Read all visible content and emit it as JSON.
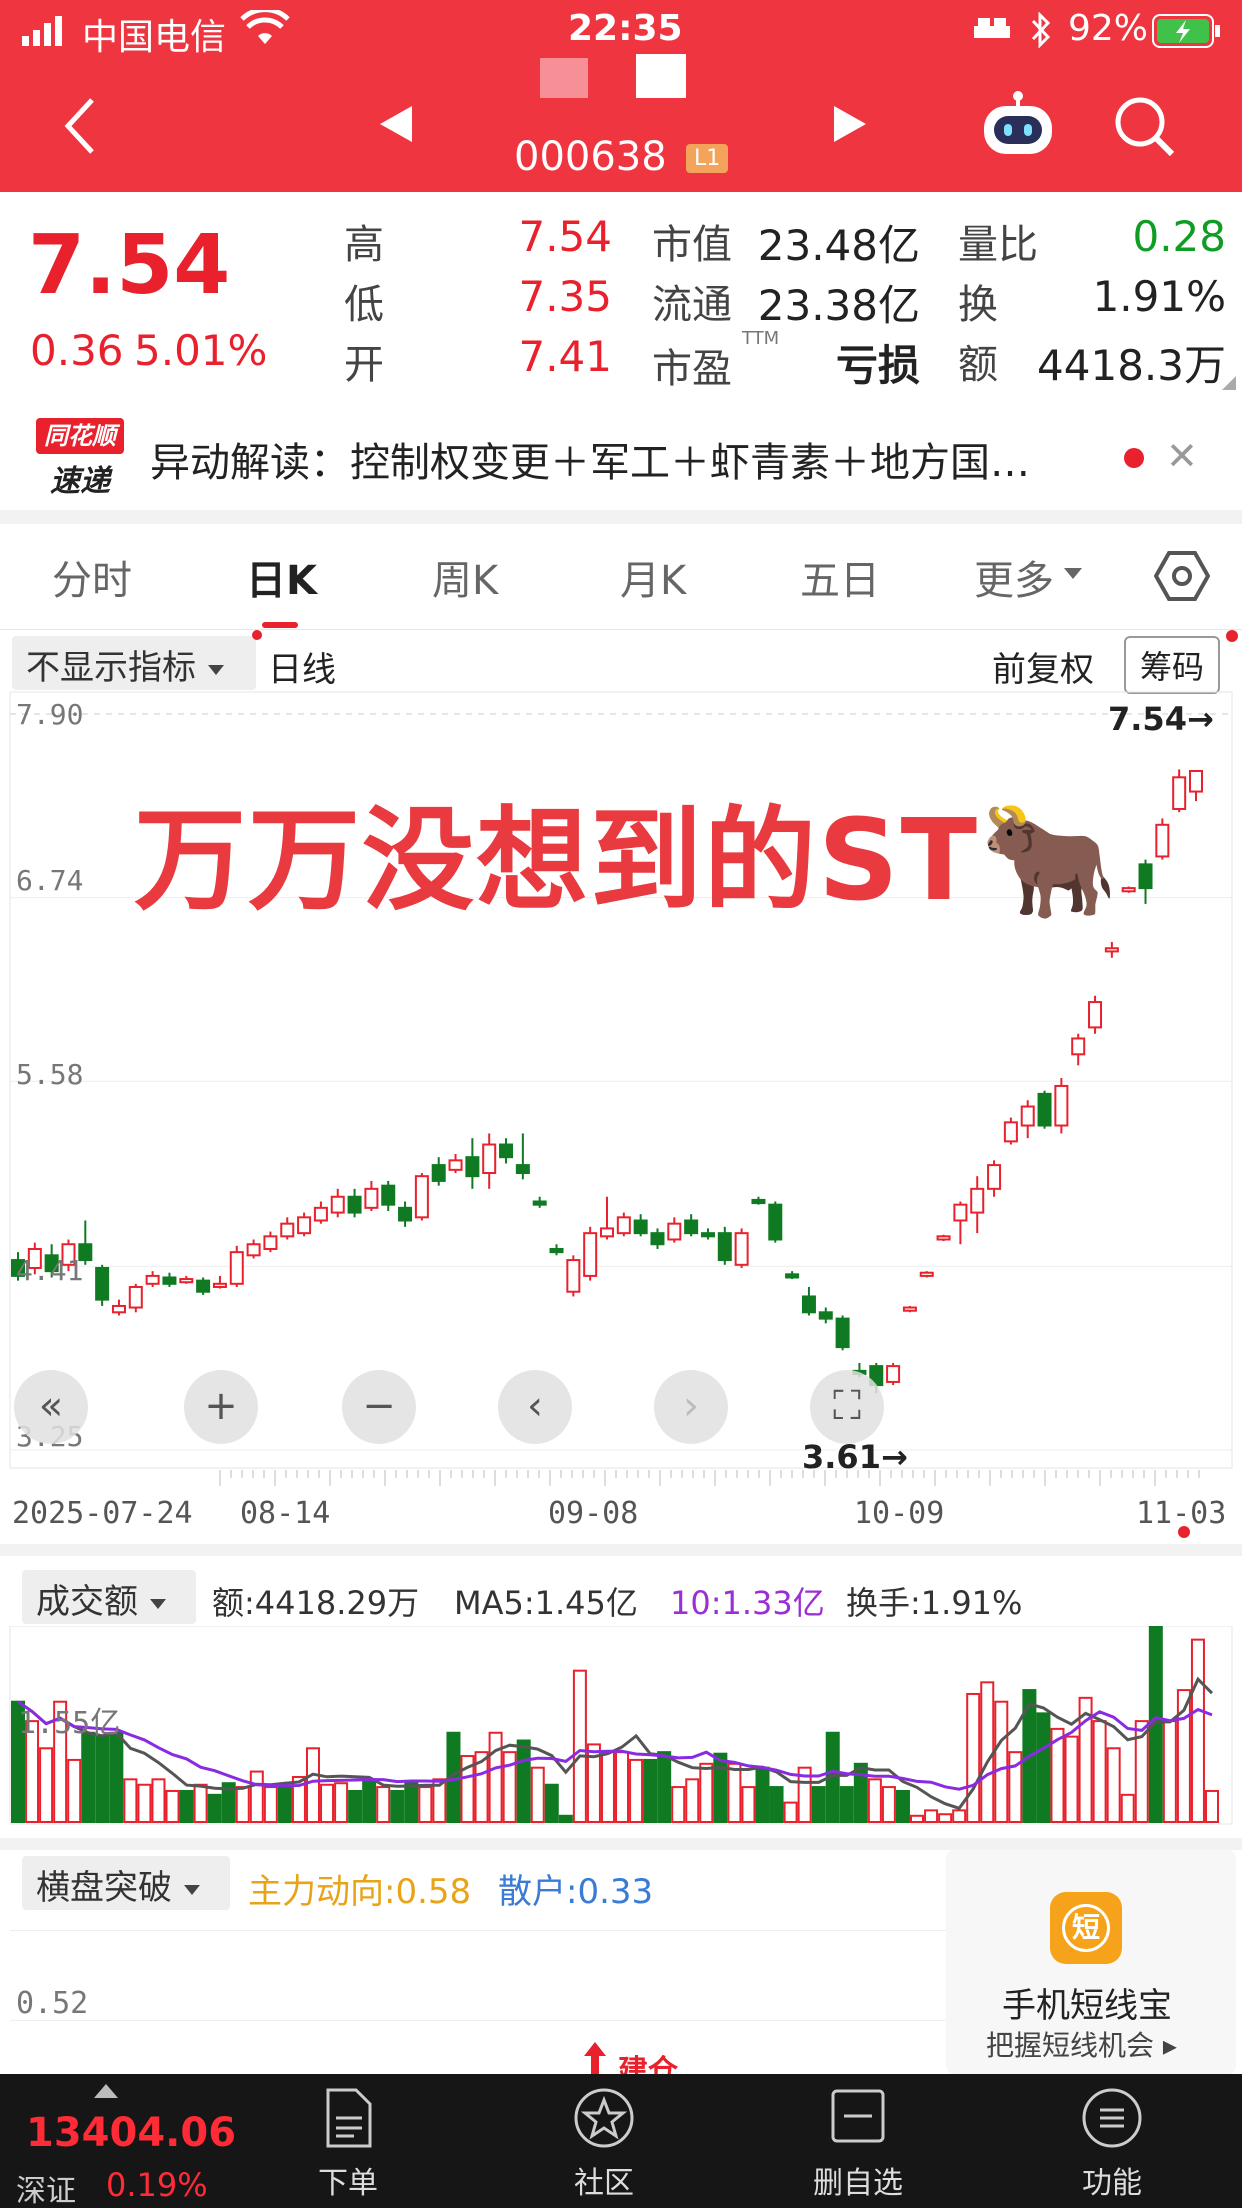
{
  "status_bar": {
    "carrier": "中国电信",
    "time": "22:35",
    "battery": "92%"
  },
  "header": {
    "stock_code": "000638",
    "level_badge": "L1"
  },
  "quote": {
    "price": "7.54",
    "change": "0.36",
    "change_pct": "5.01%",
    "high_label": "高",
    "high": "7.54",
    "low_label": "低",
    "low": "7.35",
    "open_label": "开",
    "open": "7.41",
    "mktcap_label": "市值",
    "mktcap": "23.48亿",
    "float_label": "流通",
    "float": "23.38亿",
    "pe_label": "市盈",
    "pe_sup": "TTM",
    "pe": "亏损",
    "vr_label": "量比",
    "vr": "0.28",
    "turnover_label": "换",
    "turnover": "1.91%",
    "amount_label": "额",
    "amount": "4418.3万"
  },
  "news": {
    "logo_top": "同花顺",
    "logo_bottom": "速递",
    "text": "异动解读：控制权变更＋军工＋虾青素＋地方国…",
    "close": "✕"
  },
  "tabs": [
    {
      "label": "分时"
    },
    {
      "label": "日K"
    },
    {
      "label": "周K"
    },
    {
      "label": "月K"
    },
    {
      "label": "五日"
    },
    {
      "label": "更多"
    }
  ],
  "kline": {
    "indicator_select": "不显示指标",
    "period_label": "日线",
    "adjust_label": "前复权",
    "chips_label": "筹码",
    "overlay_title": "万万没想到的ST🐂",
    "last_price_marker": "7.54→",
    "low_price_marker": "3.61→",
    "y_ticks": [
      "7.90",
      "6.74",
      "5.58",
      "4.41",
      "3.25"
    ],
    "x_ticks": [
      "2025-07-24",
      "08-14",
      "09-08",
      "10-09",
      "11-03"
    ],
    "controls": [
      "«",
      "+",
      "−",
      "‹",
      "›",
      "⛶"
    ]
  },
  "volume": {
    "select": "成交额",
    "amount": "额:4418.29万",
    "ma5": "MA5:1.45亿",
    "ma10": "10:1.33亿",
    "turnover": "换手:1.91%",
    "y_tick": "1.55亿"
  },
  "indicator": {
    "select": "横盘突破",
    "main": "主力动向:0.58",
    "retail": "散户:0.33",
    "y_tick": "0.52",
    "build_label": "建仓"
  },
  "promo": {
    "icon_char": "短",
    "title": "手机短线宝",
    "subtitle": "把握短线机会 ▸"
  },
  "bottom_bar": {
    "index_value": "13404.06",
    "index_name": "深证",
    "index_change": "0.19%",
    "items": [
      {
        "label": "下单"
      },
      {
        "label": "社区"
      },
      {
        "label": "删自选"
      },
      {
        "label": "功能"
      }
    ]
  },
  "chart_data": {
    "type": "candlestick",
    "x_start": "2025-07-24",
    "x_end": "2025-11-03",
    "ylim": [
      3.25,
      7.9
    ],
    "candles": [
      {
        "o": 4.45,
        "c": 4.35,
        "h": 4.5,
        "l": 4.32
      },
      {
        "o": 4.4,
        "c": 4.52,
        "h": 4.56,
        "l": 4.36
      },
      {
        "o": 4.48,
        "c": 4.38,
        "h": 4.55,
        "l": 4.34
      },
      {
        "o": 4.42,
        "c": 4.55,
        "h": 4.58,
        "l": 4.38
      },
      {
        "o": 4.55,
        "c": 4.45,
        "h": 4.7,
        "l": 4.42
      },
      {
        "o": 4.4,
        "c": 4.2,
        "h": 4.42,
        "l": 4.16
      },
      {
        "o": 4.12,
        "c": 4.16,
        "h": 4.2,
        "l": 4.1
      },
      {
        "o": 4.15,
        "c": 4.28,
        "h": 4.3,
        "l": 4.12
      },
      {
        "o": 4.3,
        "c": 4.35,
        "h": 4.38,
        "l": 4.28
      },
      {
        "o": 4.34,
        "c": 4.3,
        "h": 4.37,
        "l": 4.28
      },
      {
        "o": 4.31,
        "c": 4.33,
        "h": 4.35,
        "l": 4.3
      },
      {
        "o": 4.32,
        "c": 4.25,
        "h": 4.34,
        "l": 4.23
      },
      {
        "o": 4.28,
        "c": 4.3,
        "h": 4.35,
        "l": 4.27
      },
      {
        "o": 4.3,
        "c": 4.5,
        "h": 4.54,
        "l": 4.28
      },
      {
        "o": 4.48,
        "c": 4.55,
        "h": 4.58,
        "l": 4.46
      },
      {
        "o": 4.52,
        "c": 4.6,
        "h": 4.63,
        "l": 4.5
      },
      {
        "o": 4.6,
        "c": 4.68,
        "h": 4.72,
        "l": 4.58
      },
      {
        "o": 4.62,
        "c": 4.72,
        "h": 4.75,
        "l": 4.6
      },
      {
        "o": 4.7,
        "c": 4.78,
        "h": 4.82,
        "l": 4.68
      },
      {
        "o": 4.75,
        "c": 4.85,
        "h": 4.9,
        "l": 4.72
      },
      {
        "o": 4.85,
        "c": 4.75,
        "h": 4.9,
        "l": 4.72
      },
      {
        "o": 4.78,
        "c": 4.9,
        "h": 4.95,
        "l": 4.76
      },
      {
        "o": 4.92,
        "c": 4.8,
        "h": 4.95,
        "l": 4.76
      },
      {
        "o": 4.78,
        "c": 4.7,
        "h": 4.82,
        "l": 4.66
      },
      {
        "o": 4.72,
        "c": 4.98,
        "h": 5.0,
        "l": 4.7
      },
      {
        "o": 5.05,
        "c": 4.95,
        "h": 5.1,
        "l": 4.92
      },
      {
        "o": 5.02,
        "c": 5.08,
        "h": 5.12,
        "l": 5.0
      },
      {
        "o": 5.1,
        "c": 4.98,
        "h": 5.22,
        "l": 4.9
      },
      {
        "o": 5.0,
        "c": 5.18,
        "h": 5.25,
        "l": 4.9
      },
      {
        "o": 5.18,
        "c": 5.1,
        "h": 5.22,
        "l": 5.06
      },
      {
        "o": 5.05,
        "c": 5.0,
        "h": 5.25,
        "l": 4.96
      },
      {
        "o": 4.82,
        "c": 4.8,
        "h": 4.85,
        "l": 4.78
      },
      {
        "o": 4.52,
        "c": 4.5,
        "h": 4.55,
        "l": 4.48
      },
      {
        "o": 4.25,
        "c": 4.45,
        "h": 4.48,
        "l": 4.22
      },
      {
        "o": 4.35,
        "c": 4.62,
        "h": 4.66,
        "l": 4.32
      },
      {
        "o": 4.6,
        "c": 4.65,
        "h": 4.85,
        "l": 4.58
      },
      {
        "o": 4.62,
        "c": 4.72,
        "h": 4.75,
        "l": 4.6
      },
      {
        "o": 4.7,
        "c": 4.62,
        "h": 4.74,
        "l": 4.6
      },
      {
        "o": 4.62,
        "c": 4.55,
        "h": 4.65,
        "l": 4.52
      },
      {
        "o": 4.58,
        "c": 4.68,
        "h": 4.72,
        "l": 4.56
      },
      {
        "o": 4.7,
        "c": 4.62,
        "h": 4.74,
        "l": 4.6
      },
      {
        "o": 4.62,
        "c": 4.6,
        "h": 4.65,
        "l": 4.58
      },
      {
        "o": 4.62,
        "c": 4.45,
        "h": 4.66,
        "l": 4.42
      },
      {
        "o": 4.42,
        "c": 4.62,
        "h": 4.65,
        "l": 4.4
      },
      {
        "o": 4.83,
        "c": 4.81,
        "h": 4.85,
        "l": 4.8
      },
      {
        "o": 4.8,
        "c": 4.58,
        "h": 4.82,
        "l": 4.56
      },
      {
        "o": 4.36,
        "c": 4.34,
        "h": 4.38,
        "l": 4.33
      },
      {
        "o": 4.22,
        "c": 4.12,
        "h": 4.28,
        "l": 4.1
      },
      {
        "o": 4.12,
        "c": 4.08,
        "h": 4.15,
        "l": 4.05
      },
      {
        "o": 4.08,
        "c": 3.9,
        "h": 4.1,
        "l": 3.88
      },
      {
        "o": 3.75,
        "c": 3.73,
        "h": 3.8,
        "l": 3.71
      },
      {
        "o": 3.78,
        "c": 3.66,
        "h": 3.8,
        "l": 3.61
      },
      {
        "o": 3.68,
        "c": 3.78,
        "h": 3.8,
        "l": 3.66
      },
      {
        "o": 4.13,
        "c": 4.15,
        "h": 4.16,
        "l": 4.12
      },
      {
        "o": 4.35,
        "c": 4.37,
        "h": 4.38,
        "l": 4.34
      },
      {
        "o": 4.58,
        "c": 4.6,
        "h": 4.61,
        "l": 4.57
      },
      {
        "o": 4.7,
        "c": 4.8,
        "h": 4.82,
        "l": 4.55
      },
      {
        "o": 4.75,
        "c": 4.9,
        "h": 4.98,
        "l": 4.62
      },
      {
        "o": 4.9,
        "c": 5.05,
        "h": 5.08,
        "l": 4.85
      },
      {
        "o": 5.2,
        "c": 5.32,
        "h": 5.35,
        "l": 5.18
      },
      {
        "o": 5.3,
        "c": 5.42,
        "h": 5.46,
        "l": 5.22
      },
      {
        "o": 5.5,
        "c": 5.3,
        "h": 5.52,
        "l": 5.28
      },
      {
        "o": 5.3,
        "c": 5.55,
        "h": 5.6,
        "l": 5.25
      },
      {
        "o": 5.75,
        "c": 5.85,
        "h": 5.88,
        "l": 5.68
      },
      {
        "o": 5.92,
        "c": 6.08,
        "h": 6.12,
        "l": 5.88
      },
      {
        "o": 6.4,
        "c": 6.42,
        "h": 6.46,
        "l": 6.36
      },
      {
        "o": 6.78,
        "c": 6.8,
        "h": 6.81,
        "l": 6.77
      },
      {
        "o": 6.95,
        "c": 6.8,
        "h": 6.98,
        "l": 6.7
      },
      {
        "o": 7.0,
        "c": 7.2,
        "h": 7.24,
        "l": 6.98
      },
      {
        "o": 7.3,
        "c": 7.5,
        "h": 7.55,
        "l": 7.28
      },
      {
        "o": 7.41,
        "c": 7.54,
        "h": 7.54,
        "l": 7.35
      }
    ],
    "volume": {
      "unit": "亿",
      "ylim": [
        0,
        2.5
      ],
      "bars": [
        {
          "v": 1.55,
          "up": false
        },
        {
          "v": 1.3,
          "up": true
        },
        {
          "v": 0.95,
          "up": true
        },
        {
          "v": 1.55,
          "up": true
        },
        {
          "v": 0.8,
          "up": true
        },
        {
          "v": 1.15,
          "up": false
        },
        {
          "v": 1.1,
          "up": false
        },
        {
          "v": 1.15,
          "up": false
        },
        {
          "v": 0.55,
          "up": true
        },
        {
          "v": 0.48,
          "up": true
        },
        {
          "v": 0.55,
          "up": true
        },
        {
          "v": 0.4,
          "up": true
        },
        {
          "v": 0.4,
          "up": false
        },
        {
          "v": 0.48,
          "up": true
        },
        {
          "v": 0.35,
          "up": false
        },
        {
          "v": 0.5,
          "up": false
        },
        {
          "v": 0.45,
          "up": true
        },
        {
          "v": 0.65,
          "up": true
        },
        {
          "v": 0.45,
          "up": true
        },
        {
          "v": 0.45,
          "up": false
        },
        {
          "v": 0.58,
          "up": true
        },
        {
          "v": 0.95,
          "up": true
        },
        {
          "v": 0.48,
          "up": true
        },
        {
          "v": 0.5,
          "up": true
        },
        {
          "v": 0.4,
          "up": false
        },
        {
          "v": 0.55,
          "up": false
        },
        {
          "v": 0.45,
          "up": true
        },
        {
          "v": 0.4,
          "up": false
        },
        {
          "v": 0.52,
          "up": false
        },
        {
          "v": 0.45,
          "up": true
        },
        {
          "v": 0.55,
          "up": true
        },
        {
          "v": 1.15,
          "up": false
        },
        {
          "v": 0.85,
          "up": true
        },
        {
          "v": 0.9,
          "up": true
        },
        {
          "v": 1.15,
          "up": true
        },
        {
          "v": 0.9,
          "up": true
        },
        {
          "v": 1.05,
          "up": false
        },
        {
          "v": 0.7,
          "up": true
        },
        {
          "v": 0.48,
          "up": false
        },
        {
          "v": 0.08,
          "up": false
        },
        {
          "v": 1.95,
          "up": true
        },
        {
          "v": 1.0,
          "up": true
        },
        {
          "v": 0.9,
          "up": true
        },
        {
          "v": 0.9,
          "up": true
        },
        {
          "v": 0.8,
          "up": true
        },
        {
          "v": 0.8,
          "up": false
        },
        {
          "v": 0.9,
          "up": false
        },
        {
          "v": 0.45,
          "up": true
        },
        {
          "v": 0.55,
          "up": true
        },
        {
          "v": 0.75,
          "up": true
        },
        {
          "v": 0.88,
          "up": false
        },
        {
          "v": 0.75,
          "up": true
        },
        {
          "v": 0.45,
          "up": true
        },
        {
          "v": 0.7,
          "up": false
        },
        {
          "v": 0.45,
          "up": false
        },
        {
          "v": 0.25,
          "up": true
        },
        {
          "v": 0.7,
          "up": true
        },
        {
          "v": 0.45,
          "up": false
        },
        {
          "v": 1.15,
          "up": false
        },
        {
          "v": 0.45,
          "up": false
        },
        {
          "v": 0.75,
          "up": false
        },
        {
          "v": 0.55,
          "up": true
        },
        {
          "v": 0.45,
          "up": true
        },
        {
          "v": 0.4,
          "up": false
        },
        {
          "v": 0.08,
          "up": true
        },
        {
          "v": 0.15,
          "up": true
        },
        {
          "v": 0.1,
          "up": true
        },
        {
          "v": 0.15,
          "up": true
        },
        {
          "v": 1.65,
          "up": true
        },
        {
          "v": 1.8,
          "up": true
        },
        {
          "v": 1.55,
          "up": true
        },
        {
          "v": 0.9,
          "up": true
        },
        {
          "v": 1.7,
          "up": false
        },
        {
          "v": 1.4,
          "up": false
        },
        {
          "v": 1.2,
          "up": true
        },
        {
          "v": 1.1,
          "up": true
        },
        {
          "v": 1.6,
          "up": true
        },
        {
          "v": 1.3,
          "up": true
        },
        {
          "v": 0.95,
          "up": true
        },
        {
          "v": 0.35,
          "up": true
        },
        {
          "v": 1.3,
          "up": true
        },
        {
          "v": 2.55,
          "up": false
        },
        {
          "v": 1.3,
          "up": true
        },
        {
          "v": 1.7,
          "up": true
        },
        {
          "v": 2.35,
          "up": true
        },
        {
          "v": 0.4,
          "up": true
        }
      ]
    }
  },
  "colors": {
    "up": "#e8212c",
    "down": "#0f7a22",
    "header": "#ee3540",
    "ma5": "#555555",
    "ma10": "#8a2be2"
  }
}
